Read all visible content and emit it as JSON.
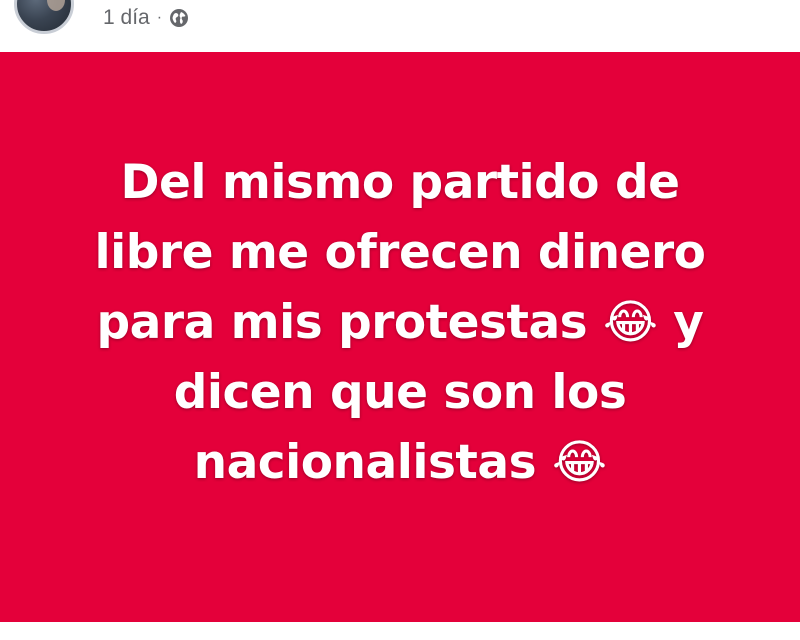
{
  "post": {
    "timestamp": "1 día",
    "separator": "·",
    "privacy_icon": "globe-icon",
    "background_color": "#e4003a",
    "text": "Del mismo partido de\nlibre me ofrecen dinero\npara mis protestas  😂 y\ndicen que son los\nnacionalistas 😂"
  }
}
